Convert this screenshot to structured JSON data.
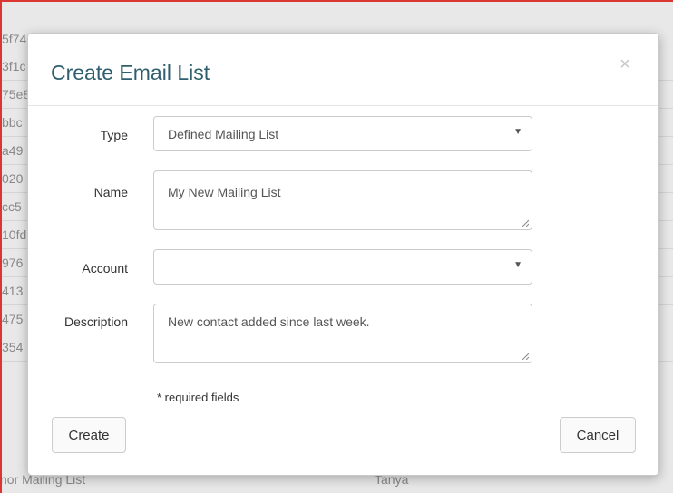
{
  "background": {
    "rows": [
      {
        "id": "5f74",
        "owner": ""
      },
      {
        "id": "3f1c",
        "owner": ""
      },
      {
        "id": "75e8",
        "owner": ""
      },
      {
        "id": "bbc",
        "owner": ""
      },
      {
        "id": "a49",
        "owner": ""
      },
      {
        "id": "020",
        "owner": ""
      },
      {
        "id": "cc5",
        "owner": ""
      },
      {
        "id": "10fd",
        "owner": ""
      },
      {
        "id": "976",
        "owner": ""
      },
      {
        "id": "413",
        "owner": ""
      },
      {
        "id": "475",
        "owner": ""
      },
      {
        "id": "354",
        "owner": ""
      },
      {
        "id": "nor Mailing List",
        "owner": "Tanya"
      }
    ]
  },
  "modal": {
    "title": "Create Email List",
    "close_glyph": "×",
    "fields": {
      "type": {
        "label": "Type",
        "value": "Defined Mailing List"
      },
      "name": {
        "label": "Name",
        "value": "My New Mailing List"
      },
      "account": {
        "label": "Account",
        "value": ""
      },
      "description": {
        "label": "Description",
        "value": "New contact added since last week."
      }
    },
    "required_note": "* required fields",
    "buttons": {
      "create": "Create",
      "cancel": "Cancel"
    }
  }
}
